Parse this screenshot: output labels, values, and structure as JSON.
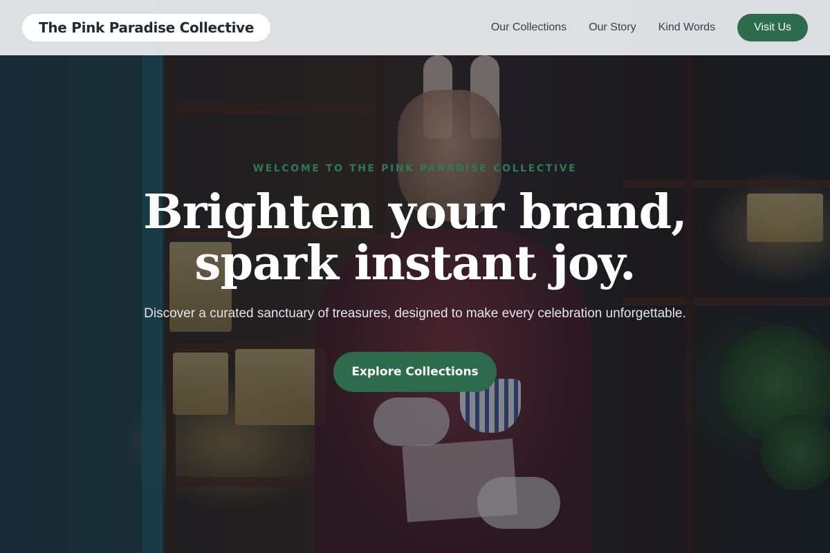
{
  "header": {
    "brand": "The Pink Paradise Collective",
    "nav": {
      "collections": "Our Collections",
      "story": "Our Story",
      "testimonials": "Kind Words",
      "visit": "Visit Us"
    }
  },
  "hero": {
    "eyebrow": "WELCOME TO THE PINK PARADISE COLLECTIVE",
    "headline_line1": "Brighten your brand,",
    "headline_line2": "spark instant joy.",
    "subheadline": "Discover a curated sanctuary of treasures, designed to make every celebration unforgettable.",
    "cta": "Explore Collections",
    "background_image": "tea-shop-with-rabbit-statue"
  },
  "colors": {
    "accent_green": "#2c6b4c",
    "eyebrow_green": "#2e7a55",
    "header_bg": "#eceef0",
    "headline": "#ffffff"
  }
}
